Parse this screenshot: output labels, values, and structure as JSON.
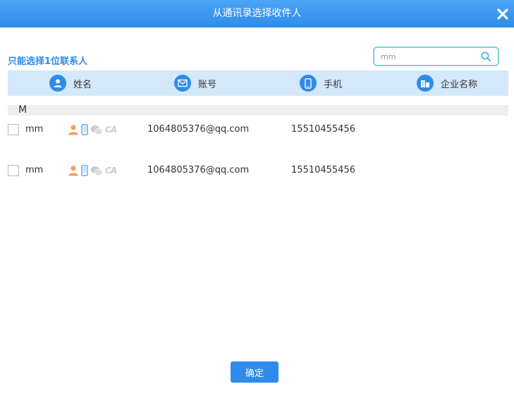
{
  "dialog": {
    "title": "从通讯录选择收件人",
    "hint": "只能选择1位联系人",
    "confirm_label": "确定"
  },
  "search": {
    "placeholder": "mm"
  },
  "columns": [
    {
      "label": "姓名",
      "icon": "person-icon"
    },
    {
      "label": "账号",
      "icon": "mail-icon"
    },
    {
      "label": "手机",
      "icon": "mobile-icon"
    },
    {
      "label": "企业名称",
      "icon": "company-icon"
    }
  ],
  "group_letter": "M",
  "contacts": [
    {
      "name": "mm",
      "account": "1064805376@qq.com",
      "phone": "15510455456",
      "ca_text": "CA"
    },
    {
      "name": "mm",
      "account": "1064805376@qq.com",
      "phone": "15510455456",
      "ca_text": "CA"
    }
  ],
  "colors": {
    "accent": "#2f8be9",
    "header_bg": "#d4e8fb",
    "search_border": "#7fd3d6",
    "person_orange": "#f5a062"
  }
}
